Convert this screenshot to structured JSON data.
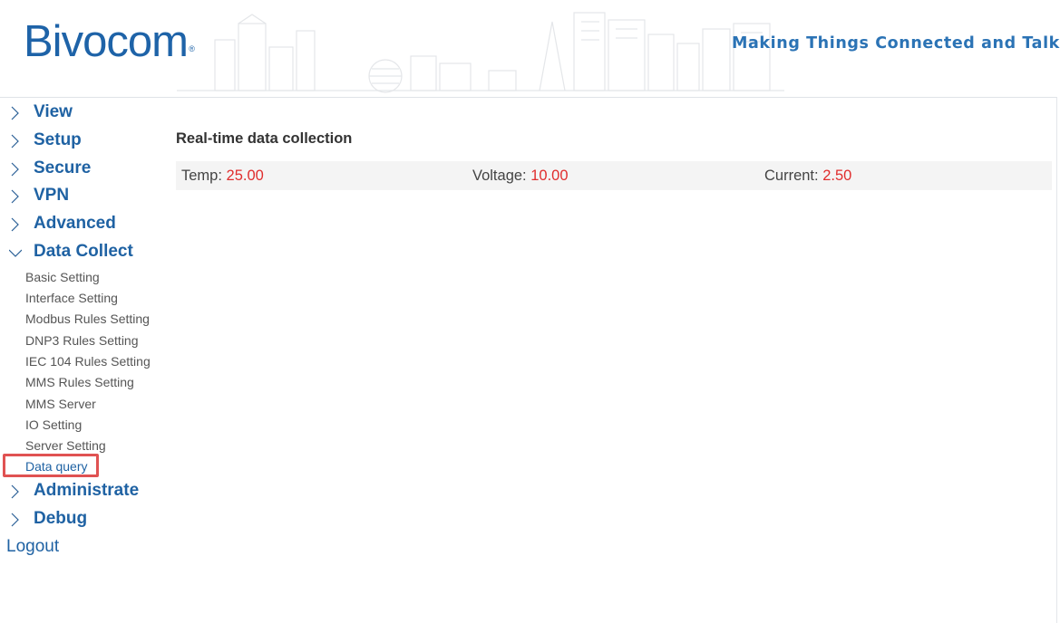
{
  "header": {
    "logo_text": "Bivocom",
    "logo_mark": "®",
    "tagline": "Making Things Connected and Talk"
  },
  "sidebar": {
    "items": [
      {
        "label": "View",
        "expanded": false
      },
      {
        "label": "Setup",
        "expanded": false
      },
      {
        "label": "Secure",
        "expanded": false
      },
      {
        "label": "VPN",
        "expanded": false
      },
      {
        "label": "Advanced",
        "expanded": false
      },
      {
        "label": "Data Collect",
        "expanded": true
      },
      {
        "label": "Administrate",
        "expanded": false
      },
      {
        "label": "Debug",
        "expanded": false
      }
    ],
    "data_collect_subitems": [
      "Basic Setting",
      "Interface Setting",
      "Modbus Rules Setting",
      "DNP3 Rules Setting",
      "IEC 104 Rules Setting",
      "MMS Rules Setting",
      "MMS Server",
      "IO Setting",
      "Server Setting",
      "Data query"
    ],
    "active_subitem": "Data query",
    "logout_label": "Logout"
  },
  "main": {
    "title": "Real-time data collection",
    "fields": [
      {
        "label": "Temp: ",
        "value": "25.00"
      },
      {
        "label": "Voltage: ",
        "value": "10.00"
      },
      {
        "label": "Current: ",
        "value": "2.50"
      }
    ]
  },
  "colors": {
    "brand_blue": "#1f62a3",
    "value_red": "#e02d2d",
    "highlight_red": "#e05252",
    "row_bg": "#f4f4f4"
  }
}
